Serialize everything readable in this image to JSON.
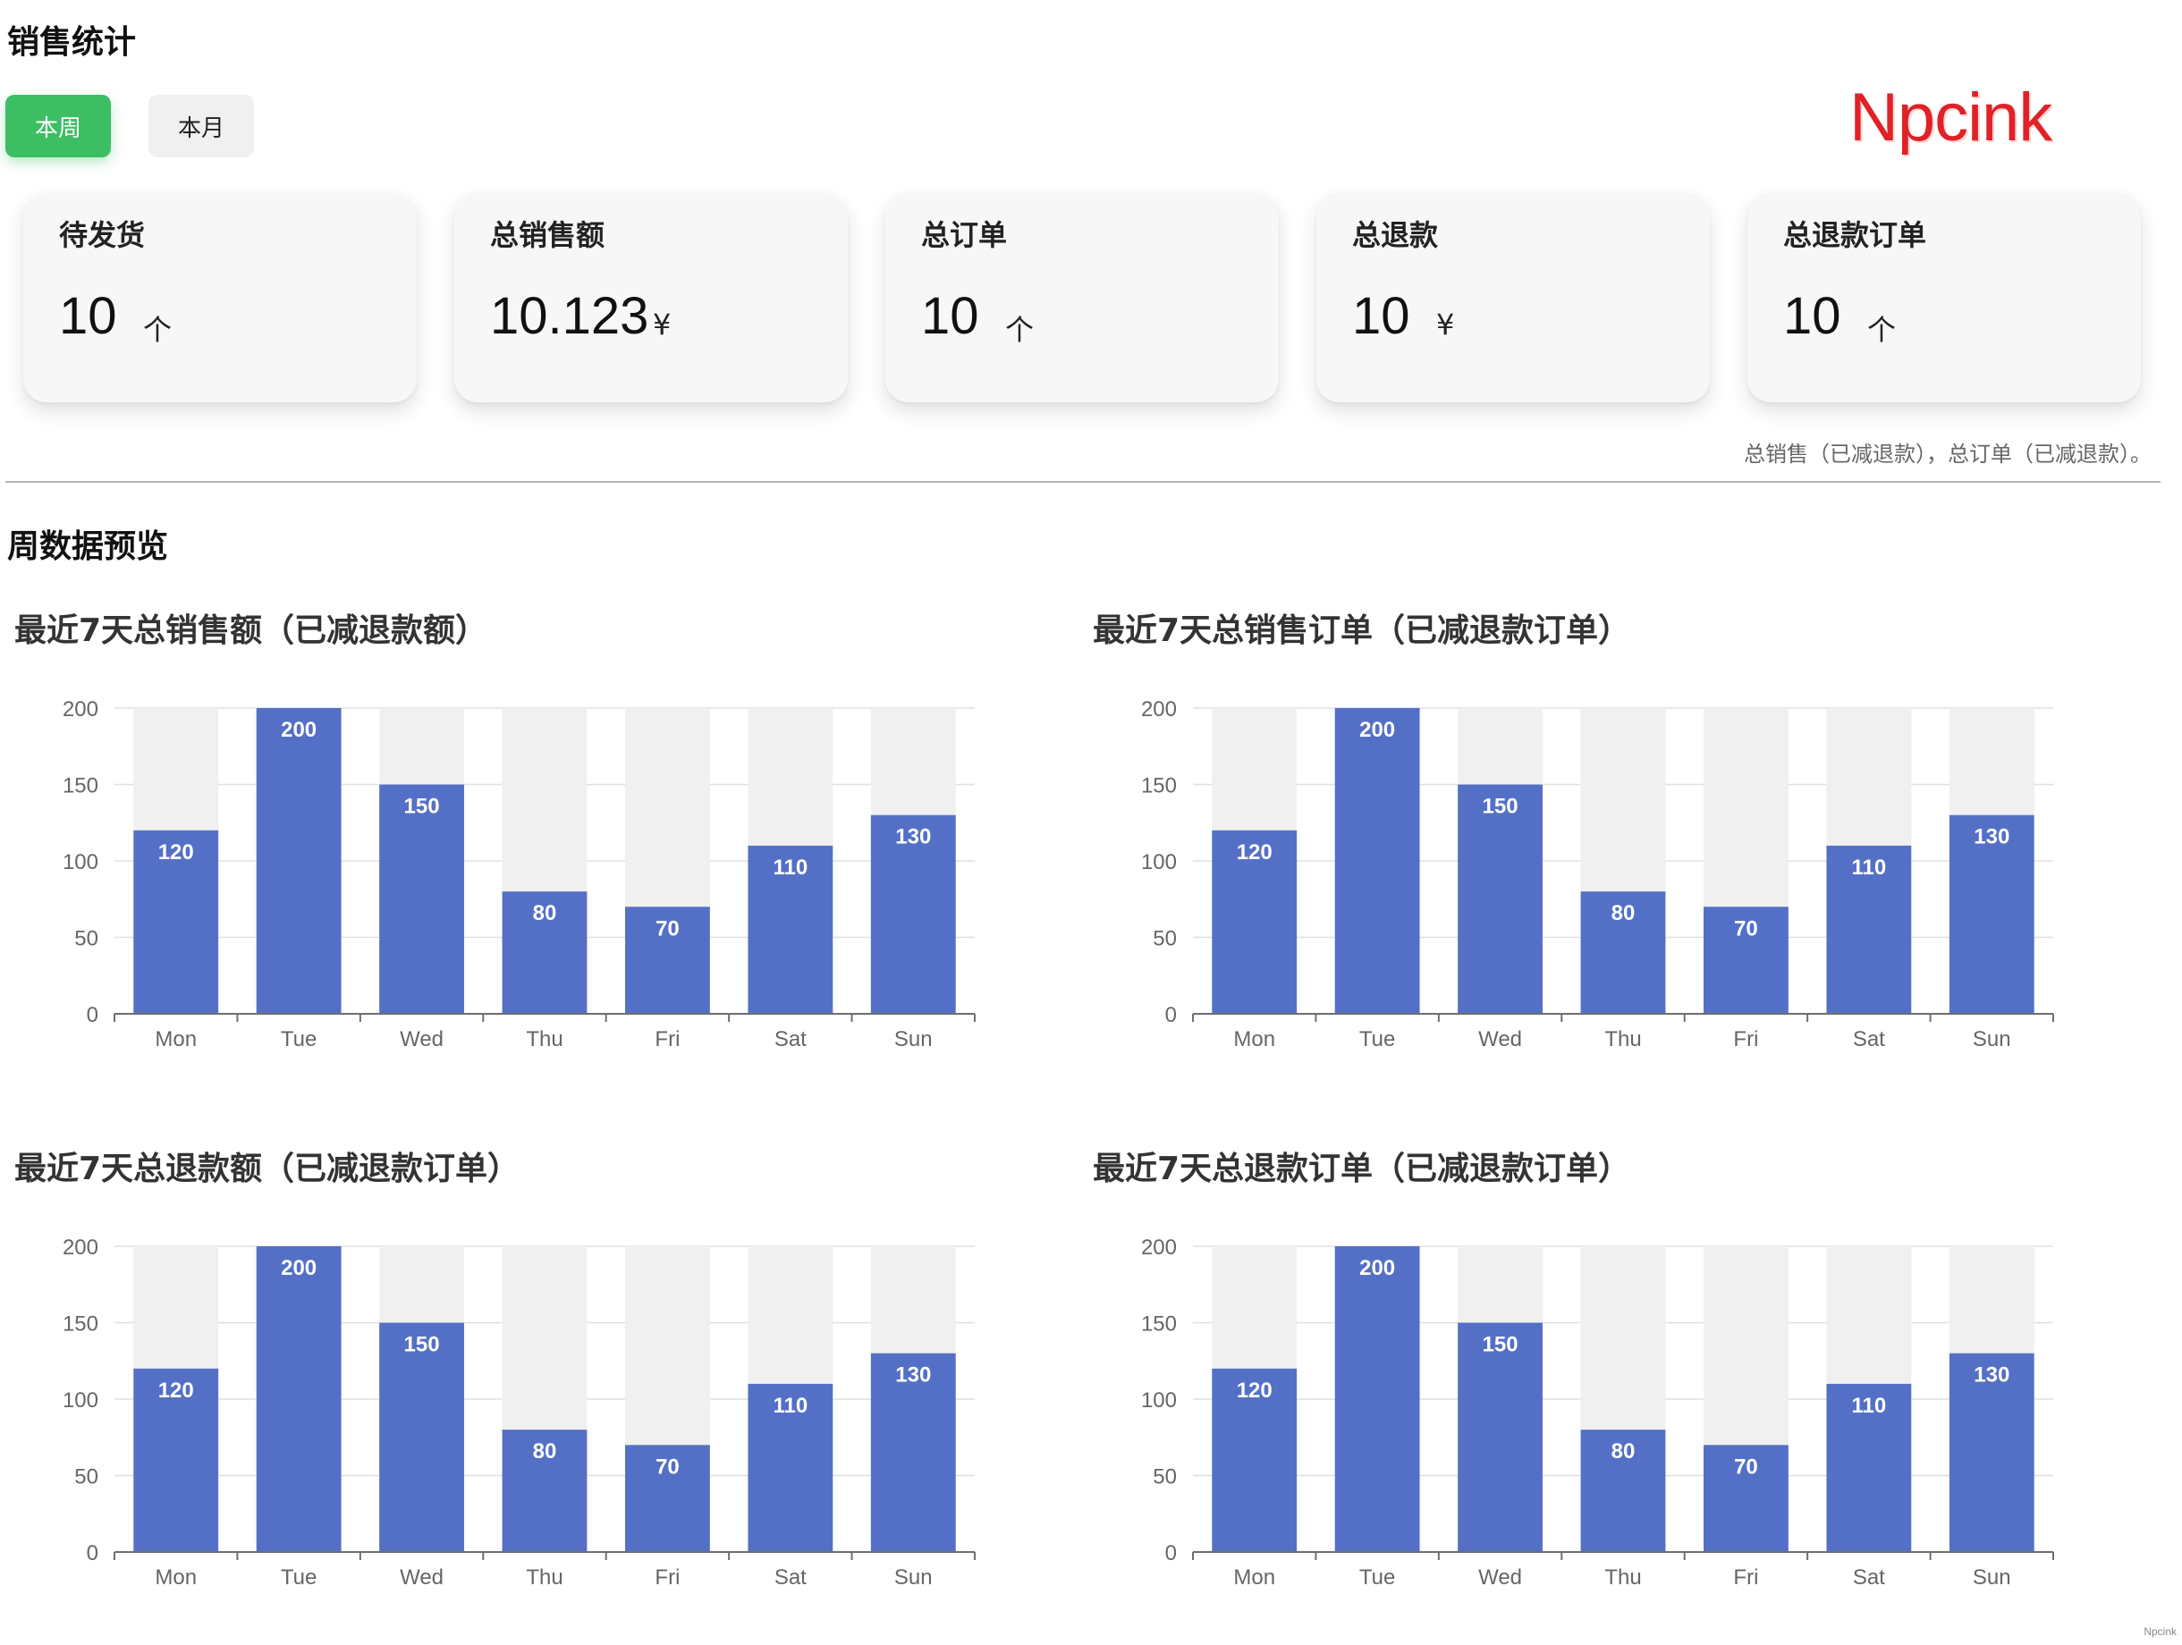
{
  "header": {
    "title": "销售统计"
  },
  "tabs": [
    {
      "label": "本周"
    },
    {
      "label": "本月"
    }
  ],
  "logo": "Npcink",
  "cards": [
    {
      "title": "待发货",
      "value": "10",
      "unit": "个"
    },
    {
      "title": "总销售额",
      "value": "10.123",
      "unit": "¥"
    },
    {
      "title": "总订单",
      "value": "10",
      "unit": "个"
    },
    {
      "title": "总退款",
      "value": "10",
      "unit": "¥"
    },
    {
      "title": "总退款订单",
      "value": "10",
      "unit": "个"
    }
  ],
  "note": "总销售（已减退款），总订单（已减退款）。",
  "overview": {
    "title": "周数据预览"
  },
  "colors": {
    "bar": "#5470c6",
    "bar_bg": "#f0f0f0",
    "accent": "#3cbf63",
    "logo": "#e02126"
  },
  "chart_data": [
    {
      "type": "bar",
      "title": "最近7天总销售额（已减退款额）",
      "categories": [
        "Mon",
        "Tue",
        "Wed",
        "Thu",
        "Fri",
        "Sat",
        "Sun"
      ],
      "values": [
        120,
        200,
        150,
        80,
        70,
        110,
        130
      ],
      "ylim": [
        0,
        200
      ],
      "yticks": [
        0,
        50,
        100,
        150,
        200
      ],
      "grid": true,
      "data_labels": true,
      "background_bars": true
    },
    {
      "type": "bar",
      "title": "最近7天总销售订单（已减退款订单）",
      "categories": [
        "Mon",
        "Tue",
        "Wed",
        "Thu",
        "Fri",
        "Sat",
        "Sun"
      ],
      "values": [
        120,
        200,
        150,
        80,
        70,
        110,
        130
      ],
      "ylim": [
        0,
        200
      ],
      "yticks": [
        0,
        50,
        100,
        150,
        200
      ],
      "grid": true,
      "data_labels": true,
      "background_bars": true
    },
    {
      "type": "bar",
      "title": "最近7天总退款额（已减退款订单）",
      "categories": [
        "Mon",
        "Tue",
        "Wed",
        "Thu",
        "Fri",
        "Sat",
        "Sun"
      ],
      "values": [
        120,
        200,
        150,
        80,
        70,
        110,
        130
      ],
      "ylim": [
        0,
        200
      ],
      "yticks": [
        0,
        50,
        100,
        150,
        200
      ],
      "grid": true,
      "data_labels": true,
      "background_bars": true
    },
    {
      "type": "bar",
      "title": "最近7天总退款订单（已减退款订单）",
      "categories": [
        "Mon",
        "Tue",
        "Wed",
        "Thu",
        "Fri",
        "Sat",
        "Sun"
      ],
      "values": [
        120,
        200,
        150,
        80,
        70,
        110,
        130
      ],
      "ylim": [
        0,
        200
      ],
      "yticks": [
        0,
        50,
        100,
        150,
        200
      ],
      "grid": true,
      "data_labels": true,
      "background_bars": true
    }
  ],
  "footer_mark": "Npcink"
}
